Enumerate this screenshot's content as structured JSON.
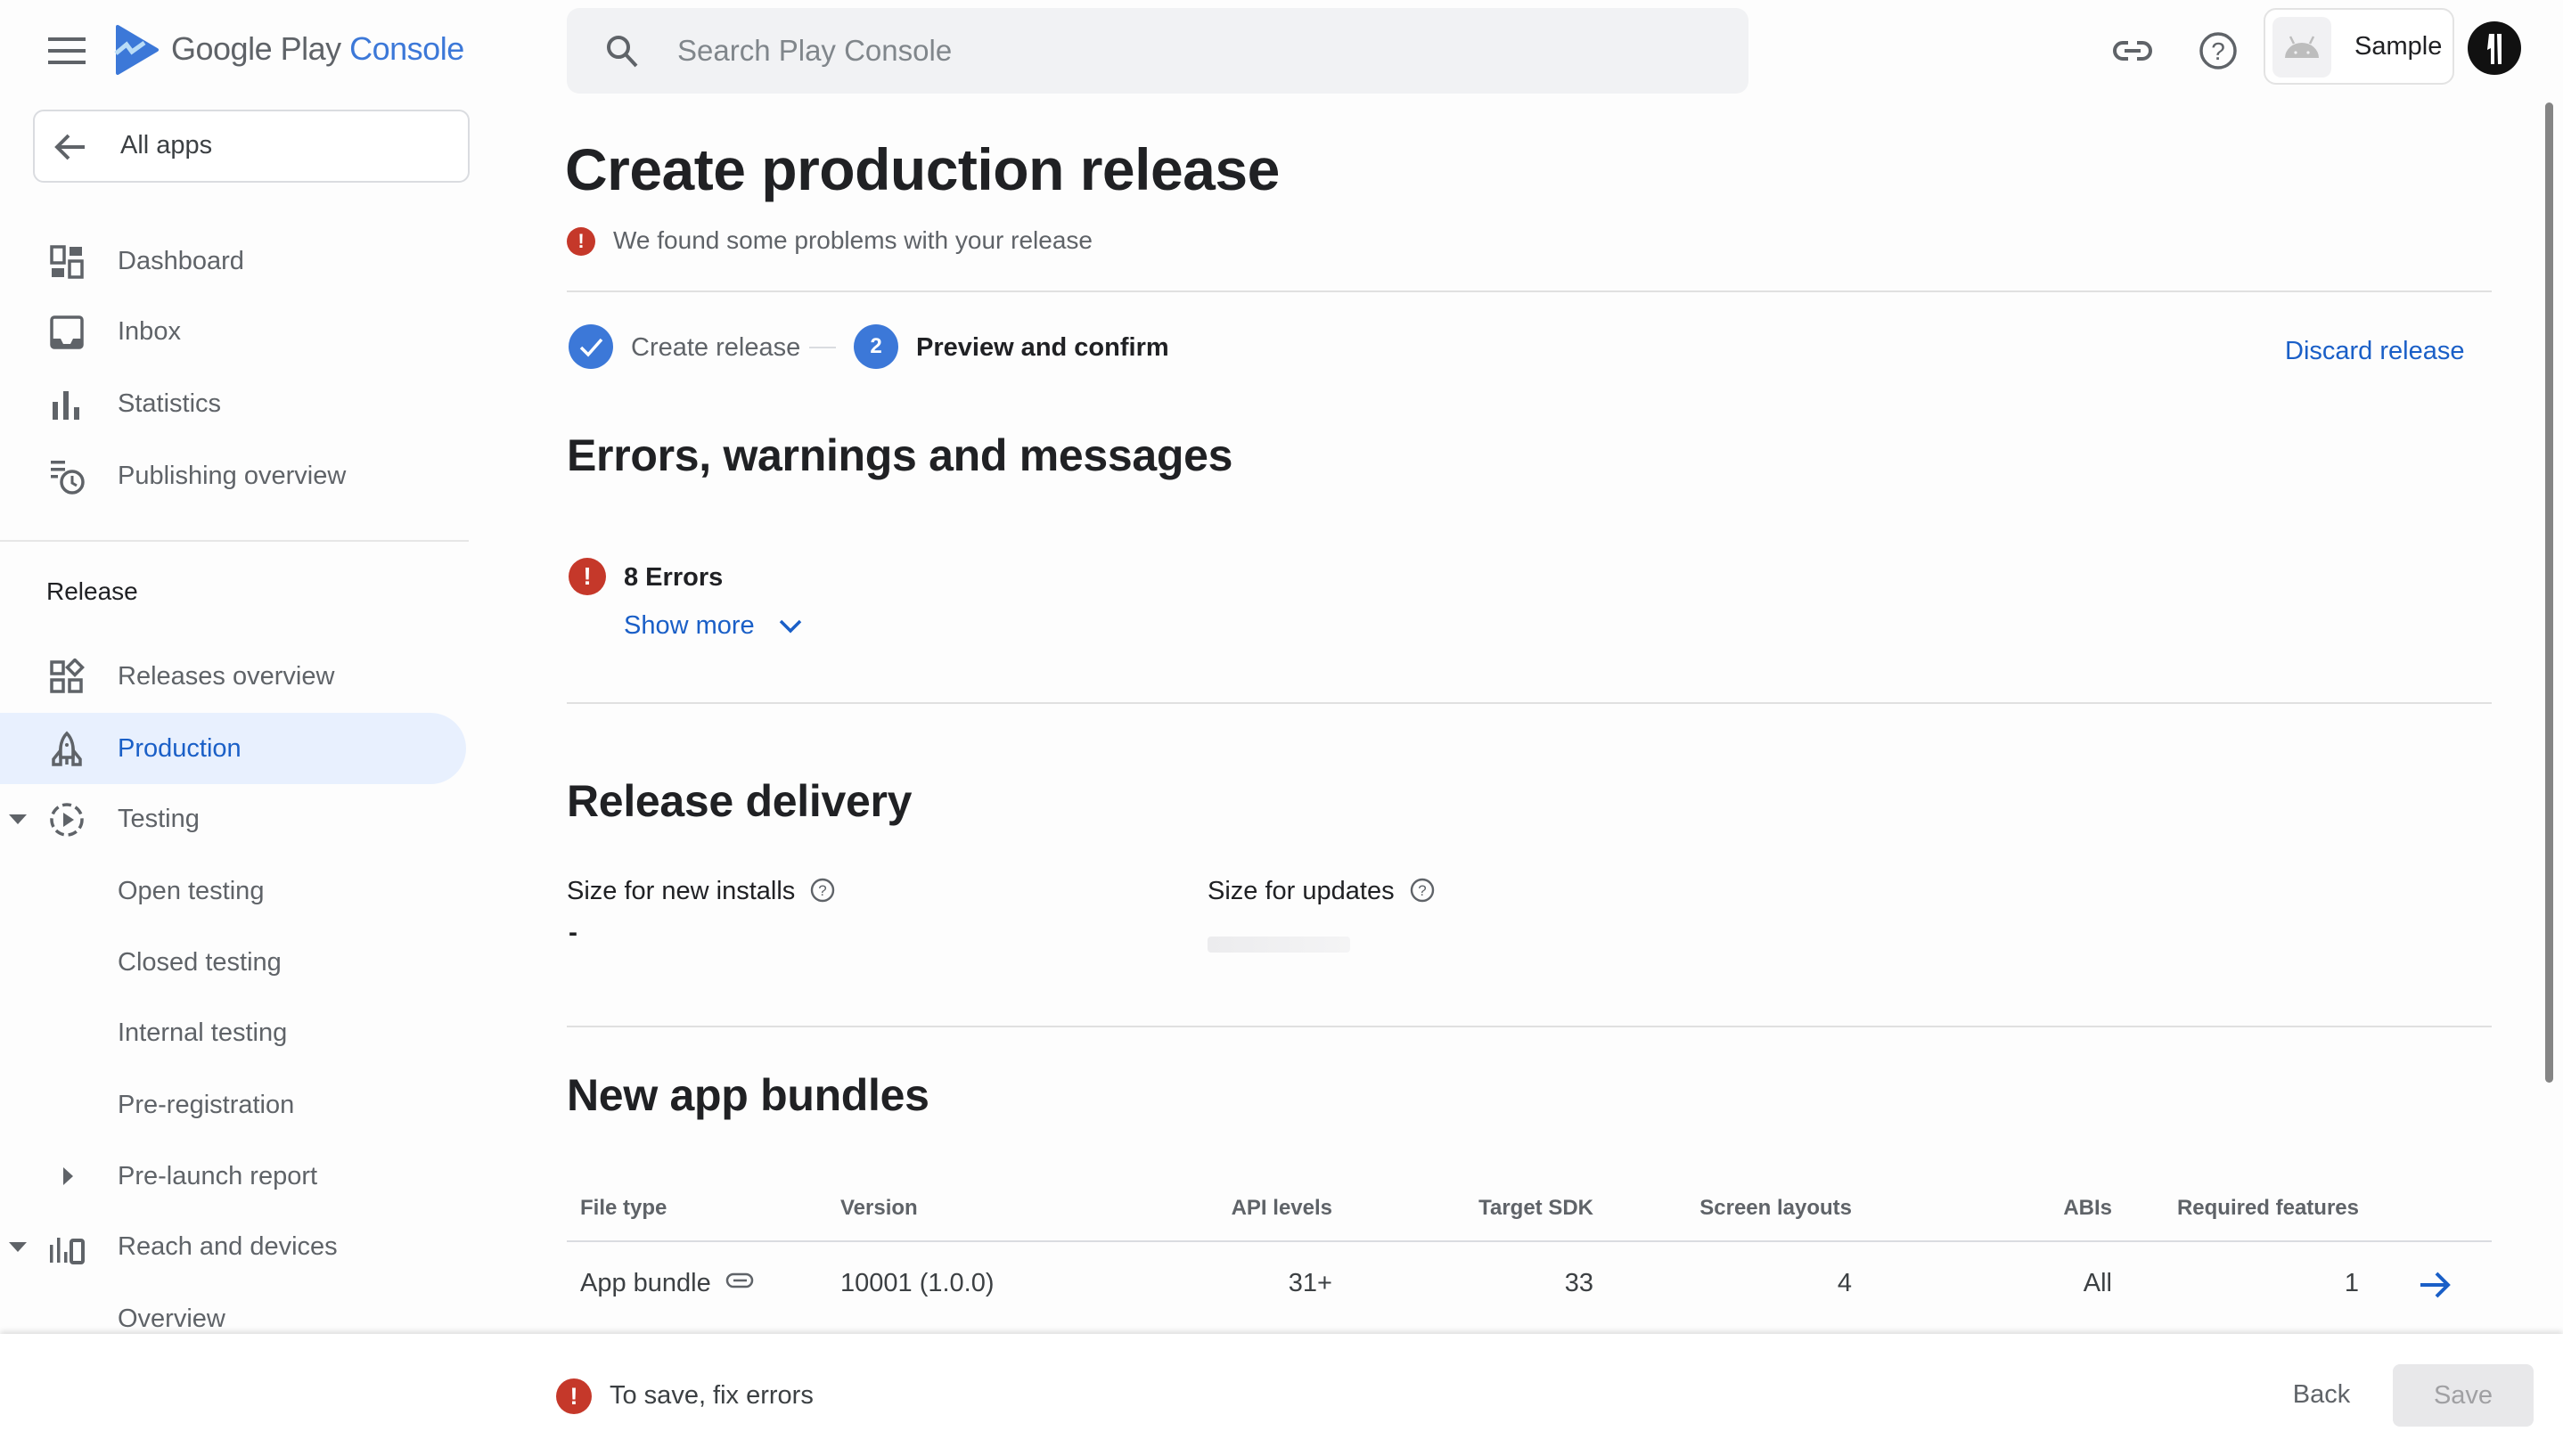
{
  "header": {
    "brand_prefix": "Google Play",
    "brand_suffix": "Console",
    "search_placeholder": "Search Play Console",
    "app_chip_name": "Sample",
    "avatar_text": "11",
    "icons": [
      "menu-icon",
      "play-console-logo",
      "search-icon",
      "link-icon",
      "help-icon",
      "android-icon",
      "avatar"
    ]
  },
  "sidebar": {
    "all_apps_label": "All apps",
    "items": [
      {
        "label": "Dashboard",
        "icon": "dashboard-icon"
      },
      {
        "label": "Inbox",
        "icon": "inbox-icon"
      },
      {
        "label": "Statistics",
        "icon": "bar-chart-icon"
      },
      {
        "label": "Publishing overview",
        "icon": "publishing-clock-icon"
      }
    ],
    "release_section_label": "Release",
    "release_items": [
      {
        "label": "Releases overview",
        "icon": "releases-overview-icon"
      },
      {
        "label": "Production",
        "icon": "rocket-icon",
        "active": true
      },
      {
        "label": "Testing",
        "icon": "testing-play-icon",
        "expanded": true
      },
      {
        "label": "Open testing"
      },
      {
        "label": "Closed testing"
      },
      {
        "label": "Internal testing"
      },
      {
        "label": "Pre-registration"
      },
      {
        "label": "Pre-launch report",
        "collapsed": true
      },
      {
        "label": "Reach and devices",
        "icon": "reach-devices-icon",
        "expanded": true
      },
      {
        "label": "Overview"
      }
    ]
  },
  "main": {
    "title": "Create production release",
    "warning_text": "We found some problems with your release",
    "stepper": {
      "step1_label": "Create release",
      "step2_number": "2",
      "step2_label": "Preview and confirm"
    },
    "discard_label": "Discard release",
    "errors_section": {
      "title": "Errors, warnings and messages",
      "errors_count_label": "8 Errors",
      "show_more_label": "Show more"
    },
    "release_delivery": {
      "title": "Release delivery",
      "size_new_installs_label": "Size for new installs",
      "size_new_installs_value": "-",
      "size_updates_label": "Size for updates"
    },
    "app_bundles": {
      "title": "New app bundles",
      "columns": [
        "File type",
        "Version",
        "API levels",
        "Target SDK",
        "Screen layouts",
        "ABIs",
        "Required features"
      ],
      "rows": [
        {
          "file_type": "App bundle",
          "version": "10001 (1.0.0)",
          "api_levels": "31+",
          "target_sdk": "33",
          "screen_layouts": "4",
          "abis": "All",
          "required_features": "1"
        }
      ]
    }
  },
  "bottom_bar": {
    "message": "To save, fix errors",
    "back_label": "Back",
    "save_label": "Save"
  },
  "colors": {
    "accent": "#3c78d8",
    "link": "#1a5fc7",
    "error": "#c5382a",
    "active_nav_bg": "#e8f0fe"
  }
}
